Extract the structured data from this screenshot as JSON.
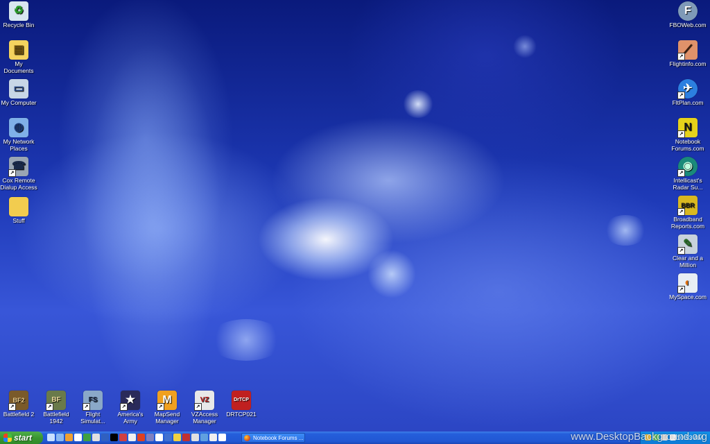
{
  "desktop": {
    "left_icons": [
      {
        "label": "Recycle Bin",
        "icon": "recycle-bin-icon",
        "color": "#d8e6f0"
      },
      {
        "label": "My Documents",
        "icon": "folder-documents-icon",
        "color": "#f4d35e"
      },
      {
        "label": "My Computer",
        "icon": "computer-icon",
        "color": "#c8d6e6"
      },
      {
        "label": "My Network Places",
        "icon": "network-icon",
        "color": "#7fb0e8"
      },
      {
        "label": "Cox Remote Dialup Access",
        "icon": "dialup-icon",
        "color": "#9aa6b4"
      },
      {
        "label": "Stuff",
        "icon": "folder-icon",
        "color": "#f2cc4f"
      }
    ],
    "right_icons": [
      {
        "label": "FBOWeb.com",
        "icon": "fboweb-icon",
        "glyph": "F",
        "color": "#7f9ab8"
      },
      {
        "label": "Flightinfo.com",
        "icon": "flightinfo-icon",
        "glyph": "",
        "color": "#e0926a"
      },
      {
        "label": "FltPlan.com",
        "icon": "fltplan-icon",
        "glyph": "✈",
        "color": "#2c7fe0"
      },
      {
        "label": "Notebook Forums.com",
        "icon": "notebook-forums-icon",
        "glyph": "N",
        "color": "#e6d21a"
      },
      {
        "label": "Intellicast's Radar Su...",
        "icon": "radar-icon",
        "glyph": "",
        "color": "#1a8a7a"
      },
      {
        "label": "Broadband Reports.com",
        "icon": "broadband-reports-icon",
        "glyph": "BBR",
        "color": "#d9b820"
      },
      {
        "label": "Clear and a Million",
        "icon": "clear-million-icon",
        "glyph": "",
        "color": "#c8d2dc"
      },
      {
        "label": "MySpace.com",
        "icon": "myspace-icon",
        "glyph": "",
        "color": "#e8eef4"
      }
    ],
    "bottom_icons": [
      {
        "label": "Battlefield 2",
        "icon": "battlefield2-icon",
        "glyph": "BF2",
        "color": "#7a5a2a"
      },
      {
        "label": "Battlefield 1942",
        "icon": "battlefield1942-icon",
        "glyph": "BF",
        "color": "#6a7a4a"
      },
      {
        "label": "Flight Simulat...",
        "icon": "flight-simulator-icon",
        "glyph": "FS",
        "color": "#8aa8c8"
      },
      {
        "label": "America's Army",
        "icon": "americas-army-icon",
        "glyph": "★",
        "color": "#2a2a5a"
      },
      {
        "label": "MapSend Manager",
        "icon": "mapsend-icon",
        "glyph": "M",
        "color": "#f0a020"
      },
      {
        "label": "VZAccess Manager",
        "icon": "vzaccess-icon",
        "glyph": "VZ",
        "color": "#e8e8e8"
      },
      {
        "label": "DRTCP021",
        "icon": "drtcp-icon",
        "glyph": "DrTCP",
        "color": "#c02020"
      }
    ]
  },
  "taskbar": {
    "start_label": "start",
    "quick_launch_colors": [
      "#c8e0ff",
      "#8ab8f0",
      "#f0a030",
      "#ffffff",
      "#40a040",
      "#e0e0e0",
      "#3060c0",
      "#000000",
      "#d04040",
      "#f0f0f0",
      "#e04020",
      "#8080c0",
      "#ffffff",
      "#4070d0",
      "#f0d040",
      "#c03030",
      "#e0e0e0",
      "#60a0e0",
      "#f0f0f0",
      "#ffffff"
    ],
    "task_item_label": "Notebook Forums ...",
    "tray_icon_colors": [
      "#f0c040",
      "#60c060",
      "#e0e0e0",
      "#ffffff"
    ],
    "clock": "10:53 AM"
  },
  "watermark": "www.DesktopBackground.org"
}
